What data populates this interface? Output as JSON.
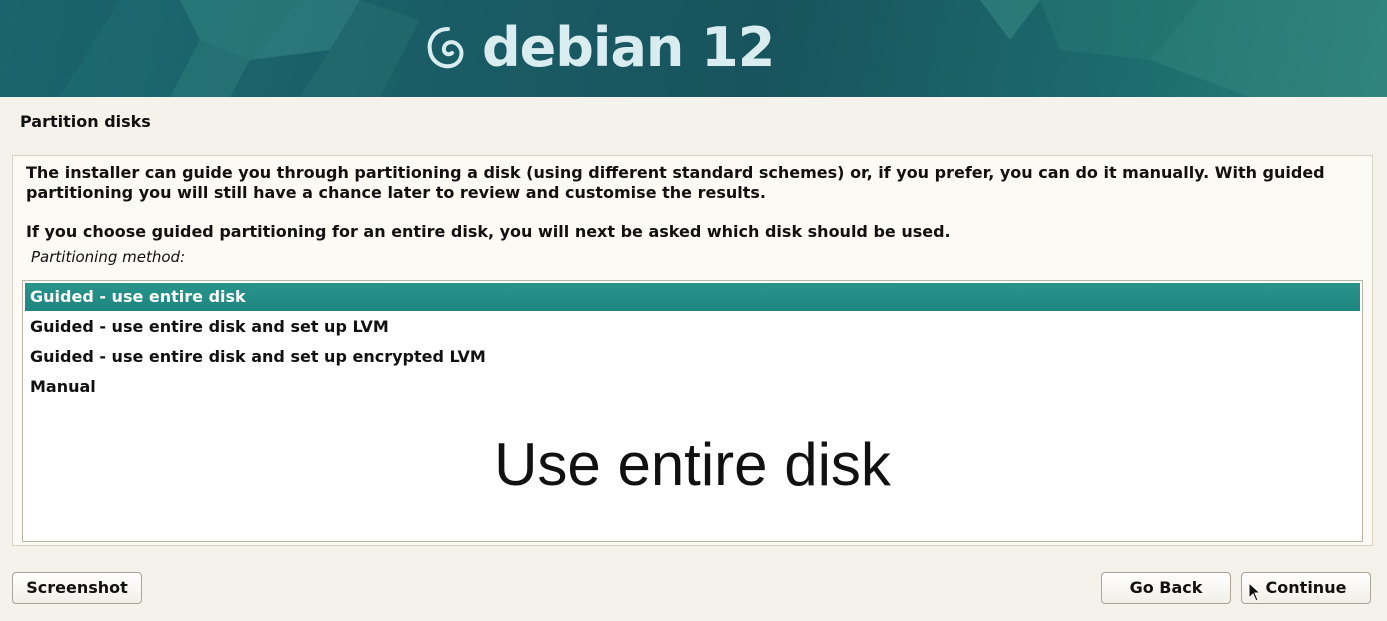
{
  "banner": {
    "brand": "debian 12",
    "logo_icon": "debian-swirl-icon",
    "colors": {
      "background": "#1a5f68",
      "text": "#d9ecf0"
    }
  },
  "page": {
    "title": "Partition disks",
    "intro_1": "The installer can guide you through partitioning a disk (using different standard schemes) or, if you prefer, you can do it manually. With guided partitioning you will still have a chance later to review and customise the results.",
    "intro_2": "If you choose guided partitioning for an entire disk, you will next be asked which disk should be used.",
    "method_label": "Partitioning method:"
  },
  "options": {
    "items": [
      {
        "label": "Guided - use entire disk",
        "selected": true
      },
      {
        "label": "Guided - use entire disk and set up LVM",
        "selected": false
      },
      {
        "label": "Guided - use entire disk and set up encrypted LVM",
        "selected": false
      },
      {
        "label": "Manual",
        "selected": false
      }
    ],
    "selection_color": "#1f8a82"
  },
  "overlay_caption": "Use entire disk",
  "buttons": {
    "screenshot": "Screenshot",
    "go_back": "Go Back",
    "continue": "Continue"
  },
  "cursor_icon": "mouse-pointer-icon"
}
